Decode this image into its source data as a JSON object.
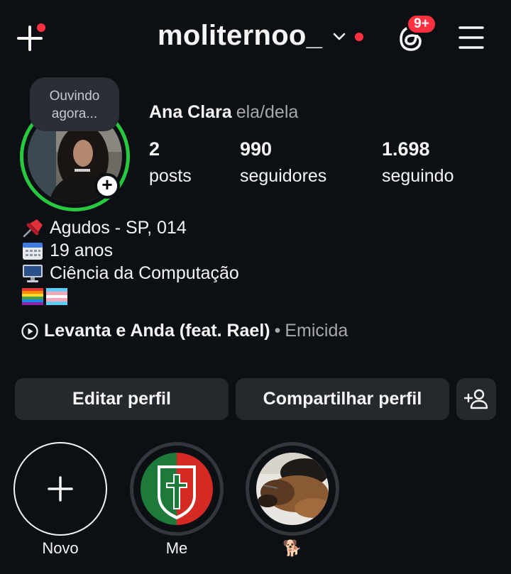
{
  "header": {
    "username": "moliternoo_",
    "threads_badge": "9+"
  },
  "note": {
    "line1": "Ouvindo",
    "line2": "agora..."
  },
  "profile": {
    "name": "Ana Clara",
    "pronouns": "ela/dela",
    "stats": [
      {
        "value": "2",
        "label": "posts"
      },
      {
        "value": "990",
        "label": "seguidores"
      },
      {
        "value": "1.698",
        "label": "seguindo"
      }
    ]
  },
  "bio": {
    "lines": [
      {
        "icon": "pushpin-icon",
        "text": "Agudos - SP, 014"
      },
      {
        "icon": "calendar-icon",
        "text": "19 anos"
      },
      {
        "icon": "computer-icon",
        "text": "Ciência da Computação"
      }
    ],
    "flags": [
      "rainbow-flag-icon",
      "transgender-flag-icon"
    ]
  },
  "music": {
    "song": "Levanta e Anda (feat. Rael)",
    "separator": "•",
    "artist": "Emicida"
  },
  "buttons": {
    "edit": "Editar perfil",
    "share": "Compartilhar perfil"
  },
  "highlights": [
    {
      "label": "Novo",
      "icon": "plus-icon"
    },
    {
      "label": "Me",
      "icon": "shield-cross-icon"
    },
    {
      "label": "🐕",
      "icon": "dog-photo"
    }
  ],
  "colors": {
    "background": "#0c1014",
    "story_ring": "#27c93f",
    "notification": "#ff3040",
    "button_bg": "#25292e",
    "secondary_text": "#a8a8a8"
  }
}
